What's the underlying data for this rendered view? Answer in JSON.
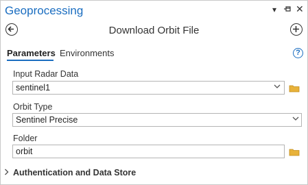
{
  "pane": {
    "title": "Geoprocessing",
    "controls": [
      "chevron-down-icon",
      "pin-icon",
      "close-icon"
    ]
  },
  "tool": {
    "title": "Download Orbit File"
  },
  "tabs": [
    {
      "label": "Parameters",
      "active": true
    },
    {
      "label": "Environments",
      "active": false
    }
  ],
  "params": {
    "input_radar": {
      "label": "Input Radar Data",
      "value": "sentinel1"
    },
    "orbit_type": {
      "label": "Orbit Type",
      "value": "Sentinel Precise"
    },
    "folder": {
      "label": "Folder",
      "value": "orbit"
    }
  },
  "sections": {
    "auth_label": "Authentication and Data Store"
  },
  "colors": {
    "accent": "#1a6dc0",
    "folder": "#e8b23a"
  }
}
